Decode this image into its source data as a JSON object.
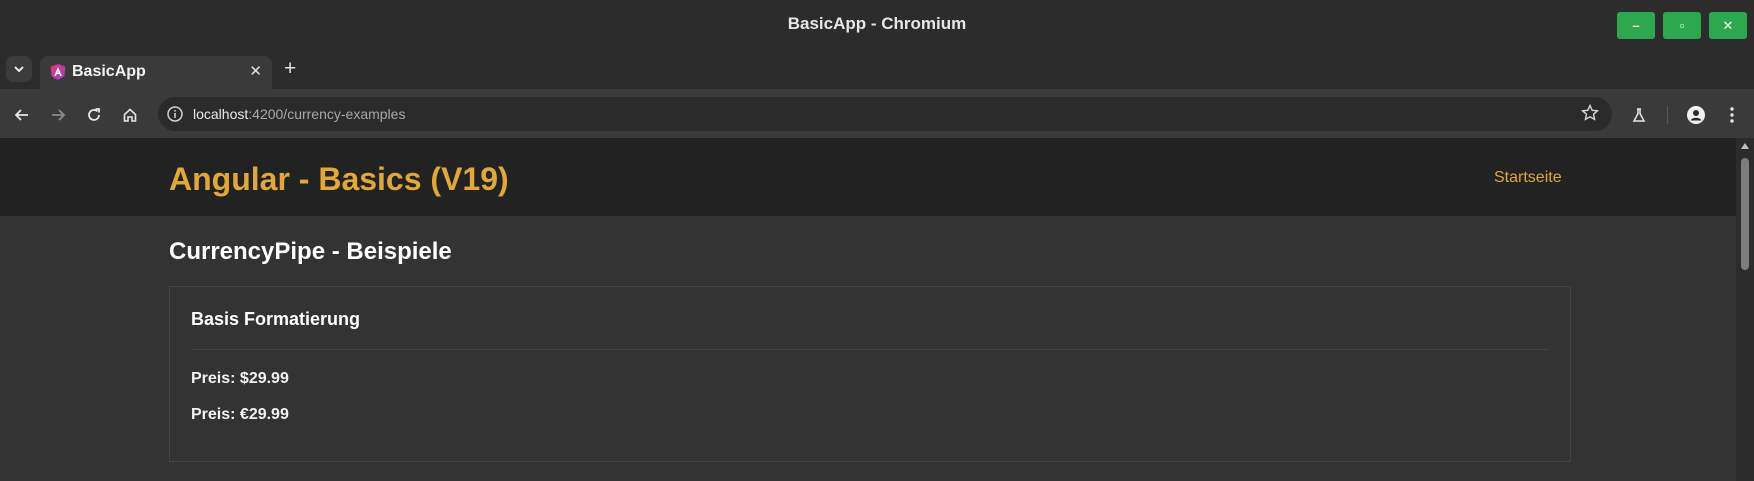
{
  "window": {
    "title": "BasicApp - Chromium",
    "controls": [
      "–",
      "▫",
      "✕"
    ],
    "control_color": "#2ea84f"
  },
  "tabs": [
    {
      "label": "BasicApp",
      "icon": "angular-logo-icon",
      "close": "✕"
    }
  ],
  "new_tab_label": "+",
  "toolbar": {
    "url_host": "localhost",
    "url_path": ":4200/currency-examples",
    "icons": [
      "back-icon",
      "forward-icon",
      "reload-icon",
      "home-icon",
      "site-info-icon",
      "bookmark-star-icon",
      "labs-flask-icon",
      "profile-icon",
      "menu-kebab-icon"
    ]
  },
  "app": {
    "title": "Angular - Basics (V19)",
    "nav_home": "Startseite",
    "accent": "#e0a73b"
  },
  "main": {
    "heading": "CurrencyPipe - Beispiele",
    "card": {
      "title": "Basis Formatierung",
      "lines": [
        "Preis: $29.99",
        "Preis: €29.99"
      ]
    }
  }
}
